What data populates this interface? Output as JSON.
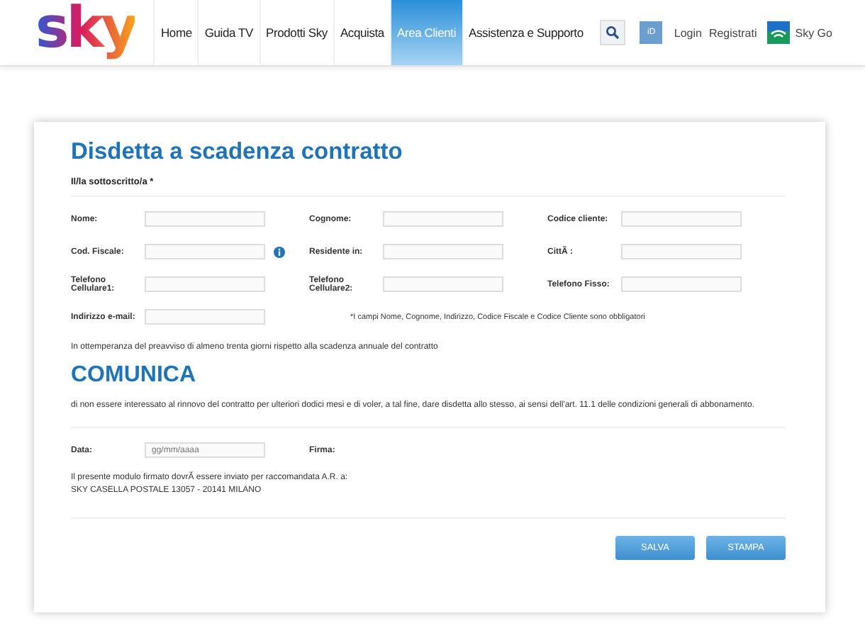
{
  "header": {
    "logo": "sky",
    "nav": [
      {
        "label": "Home",
        "selected": false
      },
      {
        "label": "Guida TV",
        "selected": false
      },
      {
        "label": "Prodotti Sky",
        "selected": false
      },
      {
        "label": "Acquista",
        "selected": false
      },
      {
        "label": "Area Clienti",
        "selected": true
      },
      {
        "label": "Assistenza e Supporto",
        "selected": false
      }
    ],
    "id_badge": "iD",
    "login": "Login",
    "register": "Registrati",
    "sky_go": "Sky Go"
  },
  "form": {
    "title": "Disdetta a scadenza contratto",
    "subtitle": "Il/la sottoscritto/a *",
    "rows": [
      {
        "fields": [
          {
            "label": "Nome:",
            "has_info": false
          },
          {
            "label": "Cognome:",
            "has_info": false
          },
          {
            "label": "Codice cliente:",
            "has_info": false
          }
        ]
      },
      {
        "fields": [
          {
            "label": "Cod. Fiscale:",
            "has_info": true
          },
          {
            "label": "Residente in:",
            "has_info": false
          },
          {
            "label": "CittÃ :",
            "has_info": false
          }
        ]
      },
      {
        "fields": [
          {
            "label": "Telefono Cellulare1:",
            "has_info": false
          },
          {
            "label": "Telefono Cellulare2:",
            "has_info": false
          },
          {
            "label": "Telefono Fisso:",
            "has_info": false
          }
        ]
      },
      {
        "fields": [
          {
            "label": "Indirizzo e-mail:",
            "has_info": false
          }
        ],
        "note": "*I campi Nome, Cognome, Indirizzo, Codice Fiscale e Codice Cliente sono obbligatori"
      }
    ],
    "notice": "In ottemperanza del preavviso di almeno trenta giorni rispetto alla scadenza annuale del contratto",
    "section_title": "COMUNICA",
    "statement": "di non essere interessato al rinnovo del contratto per ulteriori dodici mesi e di voler, a tal fine, dare disdetta allo stesso, ai sensi dell'art. 11.1 delle condizioni generali di abbonamento.",
    "date": {
      "label": "Data:",
      "placeholder": "gg/mm/aaaa"
    },
    "signature": {
      "label": "Firma:"
    },
    "address_lines": [
      "Il presente modulo firmato dovrÃ essere inviato per raccomandata A.R. a:",
      "SKY CASELLA POSTALE 13057 - 20141 MILANO"
    ],
    "buttons": [
      "SALVA",
      "STAMPA"
    ]
  }
}
